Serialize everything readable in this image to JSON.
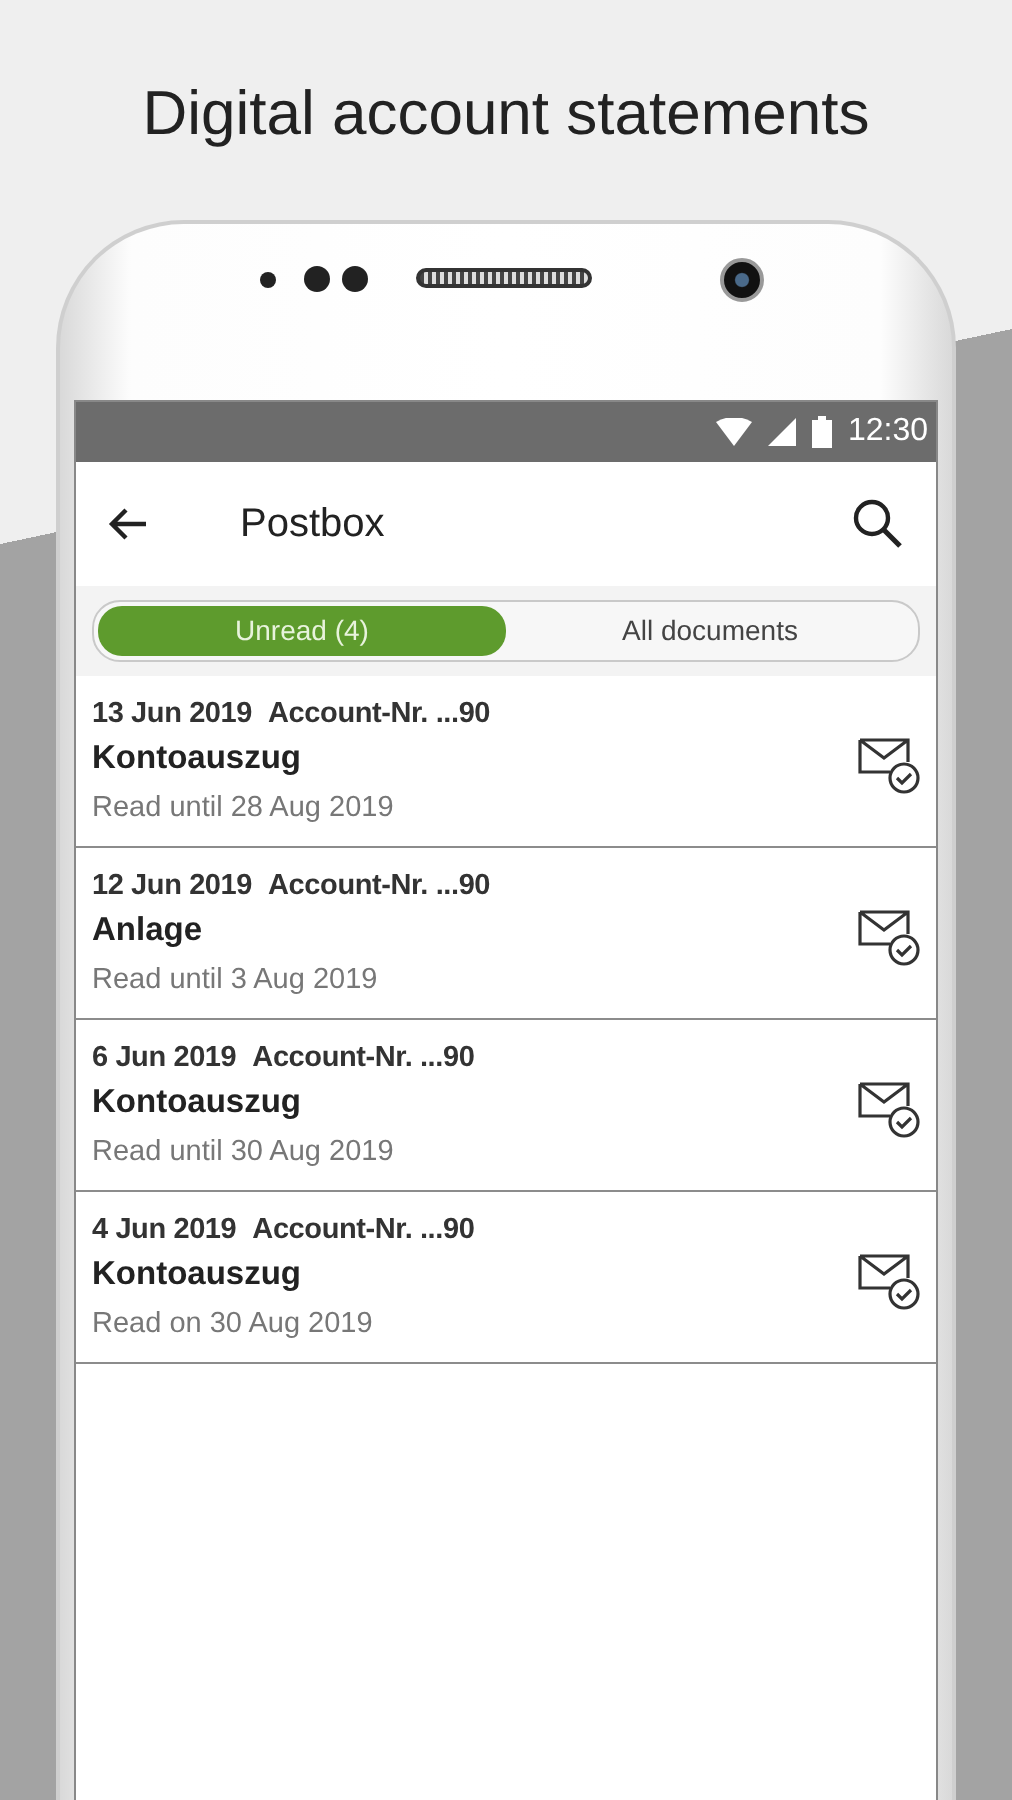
{
  "headline": "Digital account statements",
  "status_bar": {
    "time": "12:30"
  },
  "app_bar": {
    "title": "Postbox"
  },
  "tabs": [
    {
      "label": "Unread (4)",
      "selected": true
    },
    {
      "label": "All documents",
      "selected": false
    }
  ],
  "documents": [
    {
      "date": "13 Jun 2019",
      "account": "Account-Nr. ...90",
      "title": "Kontoauszug",
      "status": "Read until 28 Aug 2019"
    },
    {
      "date": "12 Jun 2019",
      "account": "Account-Nr. ...90",
      "title": "Anlage",
      "status": "Read until 3 Aug 2019"
    },
    {
      "date": "6 Jun 2019",
      "account": "Account-Nr. ...90",
      "title": "Kontoauszug",
      "status": "Read until 30 Aug 2019"
    },
    {
      "date": "4 Jun 2019",
      "account": "Account-Nr. ...90",
      "title": "Kontoauszug",
      "status": "Read on 30 Aug 2019"
    }
  ]
}
